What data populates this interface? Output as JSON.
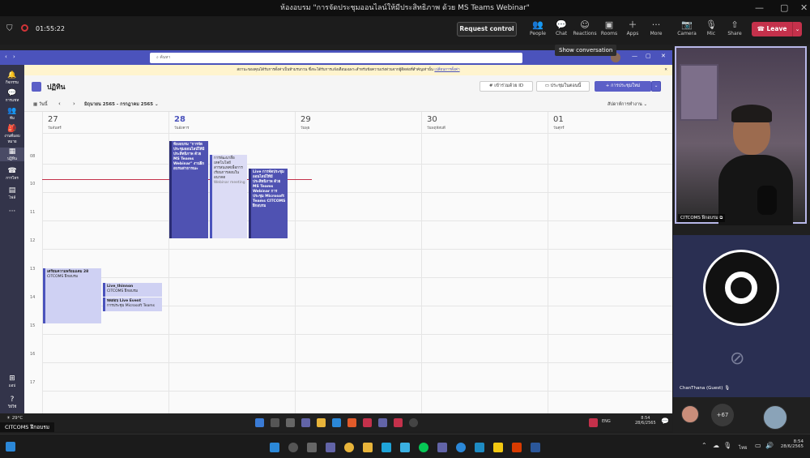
{
  "meeting": {
    "window_title": "ห้องอบรม \"การจัดประชุมออนไลน์ให้มีประสิทธิภาพ ด้วย MS Teams Webinar\"",
    "timer": "01:55:22",
    "request_control": "Request control",
    "toolbar": [
      {
        "label": "People",
        "icon": "people-icon"
      },
      {
        "label": "Chat",
        "icon": "chat-icon"
      },
      {
        "label": "Reactions",
        "icon": "reactions-icon"
      },
      {
        "label": "Rooms",
        "icon": "rooms-icon"
      },
      {
        "label": "Apps",
        "icon": "apps-icon"
      },
      {
        "label": "More",
        "icon": "more-icon"
      },
      {
        "label": "Camera",
        "icon": "camera-icon"
      },
      {
        "label": "Mic",
        "icon": "mic-icon"
      },
      {
        "label": "Share",
        "icon": "share-icon"
      }
    ],
    "leave": "Leave",
    "tooltip": "Show conversation"
  },
  "teams": {
    "search_placeholder": "ค้นหา",
    "notice": "สถานะของคุณได้รับการตั้งค่าเป็นห้ามรบกวน ซึ่งจะได้รับการแจ้งเตือนเฉพาะสำหรับข้อความเร่งด่วนจากผู้ติดต่อที่สำคัญเท่านั้น",
    "notice_link": "เปลี่ยนการตั้งค่า",
    "rail": [
      {
        "label": "กิจกรรม",
        "icon": "bell-icon"
      },
      {
        "label": "การแชท",
        "icon": "chat-icon"
      },
      {
        "label": "ทีม",
        "icon": "teams-icon"
      },
      {
        "label": "งานที่มอบหมาย",
        "icon": "assignments-icon"
      },
      {
        "label": "ปฏิทิน",
        "icon": "calendar-icon"
      },
      {
        "label": "การโทร",
        "icon": "phone-icon"
      },
      {
        "label": "ไฟล์",
        "icon": "file-icon"
      },
      {
        "label": "",
        "icon": "more-icon"
      },
      {
        "label": "แอป",
        "icon": "apps-icon"
      },
      {
        "label": "วิธีใช้",
        "icon": "help-icon"
      }
    ],
    "calendar": {
      "title": "ปฏิทิน",
      "join_with_id": "เข้าร่วมด้วย ID",
      "meet_now": "ประชุมในตอนนี้",
      "new_meeting": "+ การประชุมใหม่",
      "today": "วันนี้",
      "range": "มิถุนายน 2565 - กรกฎาคม 2565",
      "view": "สัปดาห์การทำงาน",
      "days": [
        {
          "num": "27",
          "name": "วันจันทร์"
        },
        {
          "num": "28",
          "name": "วันอังคาร"
        },
        {
          "num": "29",
          "name": "วันพุธ"
        },
        {
          "num": "30",
          "name": "วันพฤหัสบดี"
        },
        {
          "num": "01",
          "name": "วันศุกร์"
        }
      ],
      "hours": [
        "08",
        "10",
        "11",
        "12",
        "13",
        "14",
        "15",
        "16",
        "17"
      ],
      "events": {
        "e1": "ห้องอบรม \"การจัดประชุมออนไลน์ให้มีประสิทธิภาพ ด้วย MS Teams Webinar\" งานฝึกอบรมสาธารณะ",
        "e2": "การพัฒนาสื่อเทคโนโลยีสารสนเทศเพื่อการเรียนการสอนในอนาคต",
        "e2_sub": "Webinar meeting",
        "e3": "Live การจัดประชุมออนไลน์ให้มีประสิทธิภาพ ด้วย MS Teams Webinar การประชุม Microsoft Teams CITCOMS ฝึกอบรม",
        "e4": "เตรียมความพร้อมแคม 28",
        "e4_sub": "CITCOMS ฝึกอบรม",
        "e5": "Live_thinnon",
        "e5_sub": "CITCOMS ฝึกอบรม",
        "e6": "ทดสอบ Live Event",
        "e6_sub": "การประชุม Microsoft Teams"
      }
    }
  },
  "taskbar_inner": {
    "temp": "29°C",
    "lang": "ENG",
    "time": "8:54",
    "date": "28/6/2565"
  },
  "presenter_label": "CITCOMS ฝึกอบรม",
  "participants": {
    "main_name": "CITCOMS ฝึกอบรม",
    "guest_name": "ChanThana (Guest)",
    "more_count": "+67"
  },
  "windows_taskbar": {
    "lang": "ไทย",
    "time": "8:54",
    "date": "28/6/2565"
  }
}
